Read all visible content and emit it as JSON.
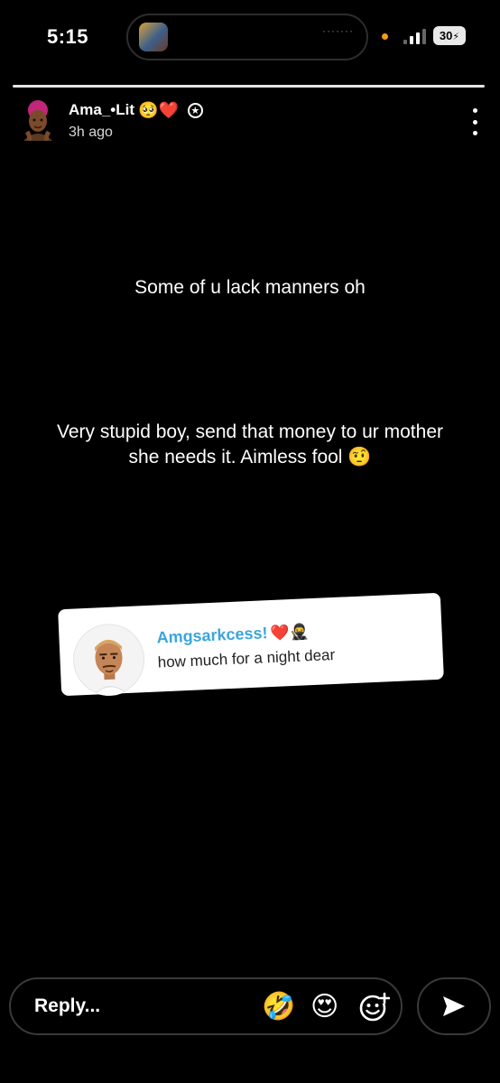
{
  "status_bar": {
    "time": "5:15",
    "island_dots": "·······",
    "battery": "30"
  },
  "story": {
    "progress": 1.0,
    "username": "Ama_•Lit",
    "username_emojis": "🥺❤️",
    "posted": "3h ago",
    "caption_1": "Some of u lack manners oh",
    "caption_2_line1": "Very stupid boy, send that money to ur mother",
    "caption_2_line2": "she needs it. Aimless fool",
    "caption_2_emoji": "🤨"
  },
  "reply_card": {
    "name": "Amgsarkcess!",
    "name_emojis": "❤️🥷",
    "message": "how much for a night dear"
  },
  "reply_bar": {
    "placeholder": "Reply...",
    "emoji_1": "🤣",
    "emoji_2": "😍"
  },
  "colors": {
    "background": "#000000",
    "reply_name": "#3aa6dc",
    "status_orange": "#f39a1e"
  }
}
